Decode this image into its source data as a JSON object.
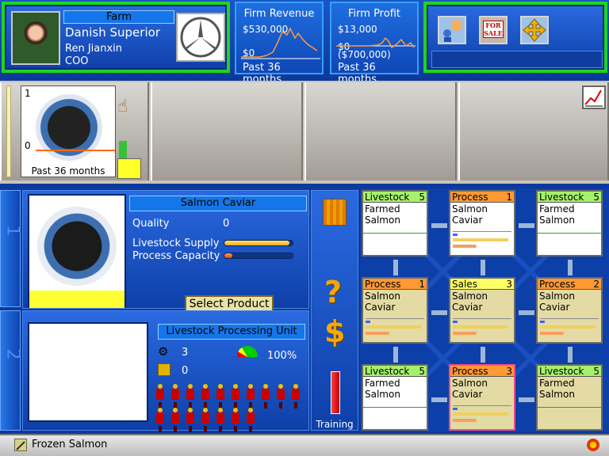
{
  "profile": {
    "firm_label": "Farm",
    "firm_name": "Danish Superior",
    "person_name": "Ren Jianxin",
    "person_title": "COO",
    "logo": "mercedes-star-logo"
  },
  "revenue": {
    "title": "Firm Revenue",
    "top": "$530,000",
    "bottom": "$0",
    "period": "Past 36 months"
  },
  "profit": {
    "title": "Firm Profit",
    "top": "$13,000",
    "mid": "$0",
    "bottom": "($700,000)",
    "period": "Past 36 months"
  },
  "toolbar_icons": [
    "people-icon",
    "for-sale-sign-icon",
    "move-arrows-icon"
  ],
  "for_sale_text": "FOR SALE",
  "strip": {
    "product_top_value": "1",
    "product_zero": "0",
    "period": "Past 36 months",
    "chart_icon": "line-chart-icon"
  },
  "product": {
    "name": "Salmon Caviar",
    "quality_label": "Quality",
    "quality_value": "0",
    "supply_label": "Livestock Supply",
    "supply_level": 0.95,
    "capacity_label": "Process Capacity",
    "capacity_level": 0.12,
    "select_button": "Select Product"
  },
  "unit": {
    "title": "Livestock Processing Unit",
    "workers_value": "3",
    "trainees_value": "0",
    "efficiency": "100%",
    "worker_count": 17
  },
  "side_tabs": [
    "1",
    "2"
  ],
  "side_column": {
    "training_label": "Training"
  },
  "grid": [
    {
      "type": "Livestock",
      "count": "5",
      "line1": "Farmed",
      "line2": "Salmon",
      "style": "ls",
      "fill": false
    },
    {
      "type": "Process",
      "count": "1",
      "line1": "Salmon",
      "line2": "Caviar",
      "style": "pr",
      "fill": false
    },
    {
      "type": "Livestock",
      "count": "5",
      "line1": "Farmed",
      "line2": "Salmon",
      "style": "ls",
      "fill": false
    },
    {
      "type": "Process",
      "count": "1",
      "line1": "Salmon",
      "line2": "Caviar",
      "style": "pr",
      "fill": true
    },
    {
      "type": "Sales",
      "count": "3",
      "line1": "Salmon",
      "line2": "Caviar",
      "style": "sa",
      "fill": true
    },
    {
      "type": "Process",
      "count": "2",
      "line1": "Salmon",
      "line2": "Caviar",
      "style": "pr",
      "fill": true
    },
    {
      "type": "Livestock",
      "count": "5",
      "line1": "Farmed",
      "line2": "Salmon",
      "style": "ls",
      "fill": false
    },
    {
      "type": "Process",
      "count": "3",
      "line1": "Salmon",
      "line2": "Caviar",
      "style": "pr",
      "fill": true
    },
    {
      "type": "Livestock",
      "count": "5",
      "line1": "Farmed",
      "line2": "Salmon",
      "style": "ls",
      "fill": true
    }
  ],
  "status": {
    "text": "Frozen Salmon",
    "left_icon": "edit-icon",
    "right_icon": "alert-icon"
  }
}
